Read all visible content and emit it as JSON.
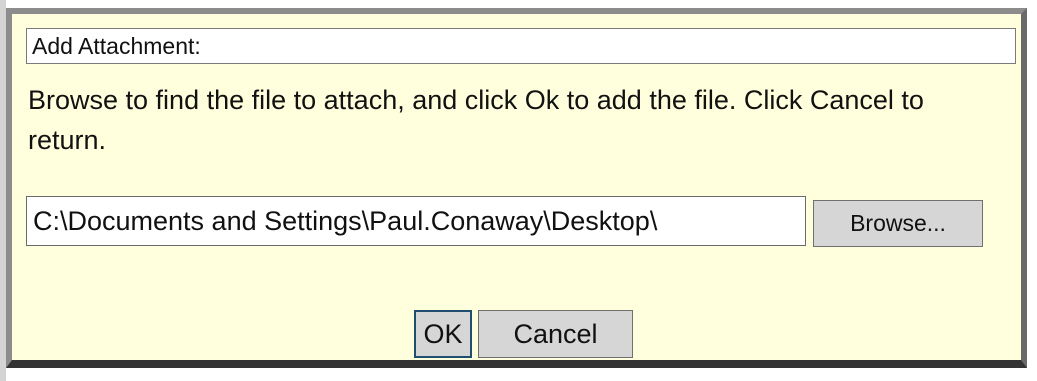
{
  "dialog": {
    "title": "Add Attachment:",
    "instructions": "Browse to find the file to attach, and click Ok to add the file. Click Cancel to return.",
    "file_path": "C:\\Documents and Settings\\Paul.Conaway\\Desktop\\",
    "browse_label": "Browse...",
    "ok_label": "OK",
    "cancel_label": "Cancel"
  },
  "colors": {
    "dialog_background": "#ffffdd",
    "border": "#8c8c8c",
    "button_face": "#d6d6d6"
  }
}
